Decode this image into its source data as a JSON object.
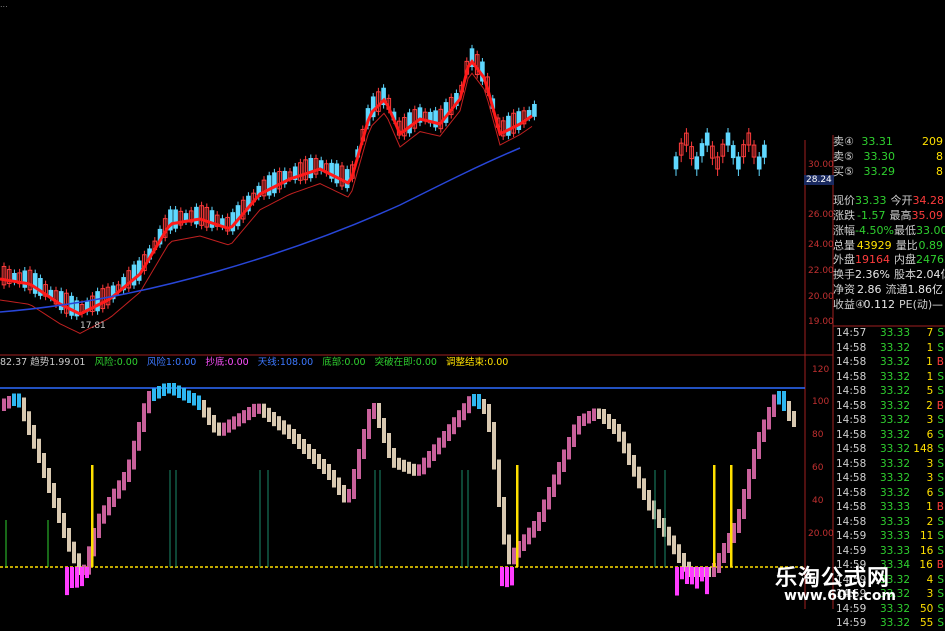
{
  "top_left_label": "...",
  "price_annotations": {
    "low": "17.81"
  },
  "price_axis": [
    "30.00",
    "28.24",
    "26.00",
    "24.00",
    "22.00",
    "20.00",
    "19.00"
  ],
  "indicator_axis": [
    "120",
    "100",
    "80",
    "60",
    "40",
    "20.00"
  ],
  "indicator_bar": {
    "prefix": "82.37 趋势1.99.01",
    "items": [
      {
        "text": "风险:0.00",
        "color": "#2fd02f"
      },
      {
        "text": "风险1:0.00",
        "color": "#3c78ff"
      },
      {
        "text": "抄底:0.00",
        "color": "#ff50ff"
      },
      {
        "text": "天线:108.00",
        "color": "#3c78ff"
      },
      {
        "text": "底部:0.00",
        "color": "#2fd02f"
      },
      {
        "text": "突破在即:0.00",
        "color": "#2fd02f"
      },
      {
        "text": "调整结束:0.00",
        "color": "#ffe000"
      }
    ]
  },
  "quote_panel": [
    {
      "l": "卖④",
      "v": "33.31",
      "vc": "dn",
      "l2": "",
      "v2": "209",
      "v2c": "ylw"
    },
    {
      "l": "卖⑤",
      "v": "33.30",
      "vc": "dn",
      "l2": "",
      "v2": "8",
      "v2c": "ylw"
    },
    {
      "l": "买⑤",
      "v": "33.29",
      "vc": "dn",
      "l2": "",
      "v2": "8",
      "v2c": "ylw"
    },
    {
      "l": "",
      "v": "",
      "vc": "",
      "l2": "",
      "v2": "",
      "v2c": ""
    },
    {
      "l": "现价",
      "v": "33.33",
      "vc": "dn",
      "l2": "今开",
      "v2": "34.28",
      "v2c": "up"
    },
    {
      "l": "涨跌",
      "v": "-1.57",
      "vc": "dn",
      "l2": "最高",
      "v2": "35.09",
      "v2c": "up"
    },
    {
      "l": "涨幅",
      "v": "-4.50%",
      "vc": "dn",
      "l2": "最低",
      "v2": "33.00",
      "v2c": "dn"
    },
    {
      "l": "总量",
      "v": "43929",
      "vc": "ylw",
      "l2": "量比",
      "v2": "0.89",
      "v2c": "dn"
    },
    {
      "l": "外盘",
      "v": "19164",
      "vc": "up",
      "l2": "内盘",
      "v2": "24765",
      "v2c": "dn"
    },
    {
      "l": "换手",
      "v": "2.36%",
      "vc": "wht",
      "l2": "股本",
      "v2": "2.04亿",
      "v2c": "wht"
    },
    {
      "l": "净资",
      "v": "2.86",
      "vc": "wht",
      "l2": "流通",
      "v2": "1.86亿",
      "v2c": "wht"
    },
    {
      "l": "收益④",
      "v": "0.112",
      "vc": "wht",
      "l2": "PE(动)",
      "v2": "—",
      "v2c": "wht"
    }
  ],
  "ticks": [
    {
      "t": "14:57",
      "p": "33.33",
      "v": "7",
      "s": "S"
    },
    {
      "t": "14:58",
      "p": "33.32",
      "v": "1",
      "s": "S"
    },
    {
      "t": "14:58",
      "p": "33.32",
      "v": "1",
      "s": "B"
    },
    {
      "t": "14:58",
      "p": "33.32",
      "v": "1",
      "s": "S"
    },
    {
      "t": "14:58",
      "p": "33.32",
      "v": "5",
      "s": "S"
    },
    {
      "t": "14:58",
      "p": "33.32",
      "v": "2",
      "s": "B"
    },
    {
      "t": "14:58",
      "p": "33.32",
      "v": "3",
      "s": "S"
    },
    {
      "t": "14:58",
      "p": "33.32",
      "v": "6",
      "s": "S"
    },
    {
      "t": "14:58",
      "p": "33.32",
      "v": "148",
      "s": "S"
    },
    {
      "t": "14:58",
      "p": "33.32",
      "v": "3",
      "s": "S"
    },
    {
      "t": "14:58",
      "p": "33.32",
      "v": "3",
      "s": "S"
    },
    {
      "t": "14:58",
      "p": "33.32",
      "v": "6",
      "s": "S"
    },
    {
      "t": "14:58",
      "p": "33.33",
      "v": "1",
      "s": "B"
    },
    {
      "t": "14:58",
      "p": "33.33",
      "v": "2",
      "s": "S"
    },
    {
      "t": "14:59",
      "p": "33.33",
      "v": "11",
      "s": "S"
    },
    {
      "t": "14:59",
      "p": "33.33",
      "v": "16",
      "s": "S"
    },
    {
      "t": "14:59",
      "p": "33.34",
      "v": "16",
      "s": "B"
    },
    {
      "t": "14:59",
      "p": "33.32",
      "v": "4",
      "s": "S"
    },
    {
      "t": "14:59",
      "p": "33.32",
      "v": "3",
      "s": "S"
    },
    {
      "t": "14:59",
      "p": "33.32",
      "v": "50",
      "s": "S"
    },
    {
      "t": "14:59",
      "p": "33.32",
      "v": "55",
      "s": "S"
    }
  ],
  "watermark": {
    "title": "乐淘公式网",
    "url": "www.60lt.com"
  },
  "colors": {
    "up": "#ff3c3c",
    "down": "#2fd02f",
    "ma_main": "#ff1a1a",
    "ma_long": "#2846d8",
    "ind_pink": "#c8609a",
    "ind_beige": "#d8c8b0",
    "ind_cyan": "#2eb6f0",
    "ind_magenta": "#ff3cff",
    "yellow": "#ffe000"
  }
}
